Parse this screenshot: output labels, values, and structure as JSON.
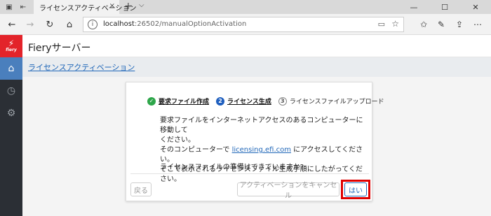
{
  "browser": {
    "tab_title": "ライセンスアクティベーション",
    "tab_close_icon": "×",
    "new_tab_icon": "+",
    "tab_dropdown_icon": "⌵",
    "url_host": "localhost",
    "url_rest": ":26502/manualOptionActivation",
    "window_controls": [
      "—",
      "☐",
      "✕"
    ]
  },
  "app": {
    "logo_text": "fiery",
    "header_title": "Fieryサーバー",
    "breadcrumb": "ライセンスアクティベーション",
    "accent_color": "#4a7fbd",
    "brand_color": "#e3232a"
  },
  "sidebar": {
    "items": [
      {
        "icon": "home-icon",
        "active": true
      },
      {
        "icon": "history-icon",
        "active": false
      },
      {
        "icon": "gear-icon",
        "active": false
      }
    ]
  },
  "dialog": {
    "steps": [
      {
        "number": "✓",
        "label": "要求ファイル作成",
        "state": "done"
      },
      {
        "number": "2",
        "label": "ライセンス生成",
        "state": "current"
      },
      {
        "number": "3",
        "label": "ライセンスファイルアップロード",
        "state": "todo"
      }
    ],
    "message_line1": "要求ファイルをインターネットアクセスのあるコンピューターに移動して",
    "message_line2": "ください。",
    "message_line3_pre": "そのコンピューターで ",
    "message_link": "licensing.efi.com",
    "message_line3_post": " にアクセスしてください。",
    "message_line4": "そこで表示されるライセンスファイル生成手順にしたがってください。",
    "question": "ライセンスファイルの準備はできていますか?",
    "back_button": "戻る",
    "cancel_button": "アクティベーションをキャンセル",
    "yes_button": "はい"
  }
}
